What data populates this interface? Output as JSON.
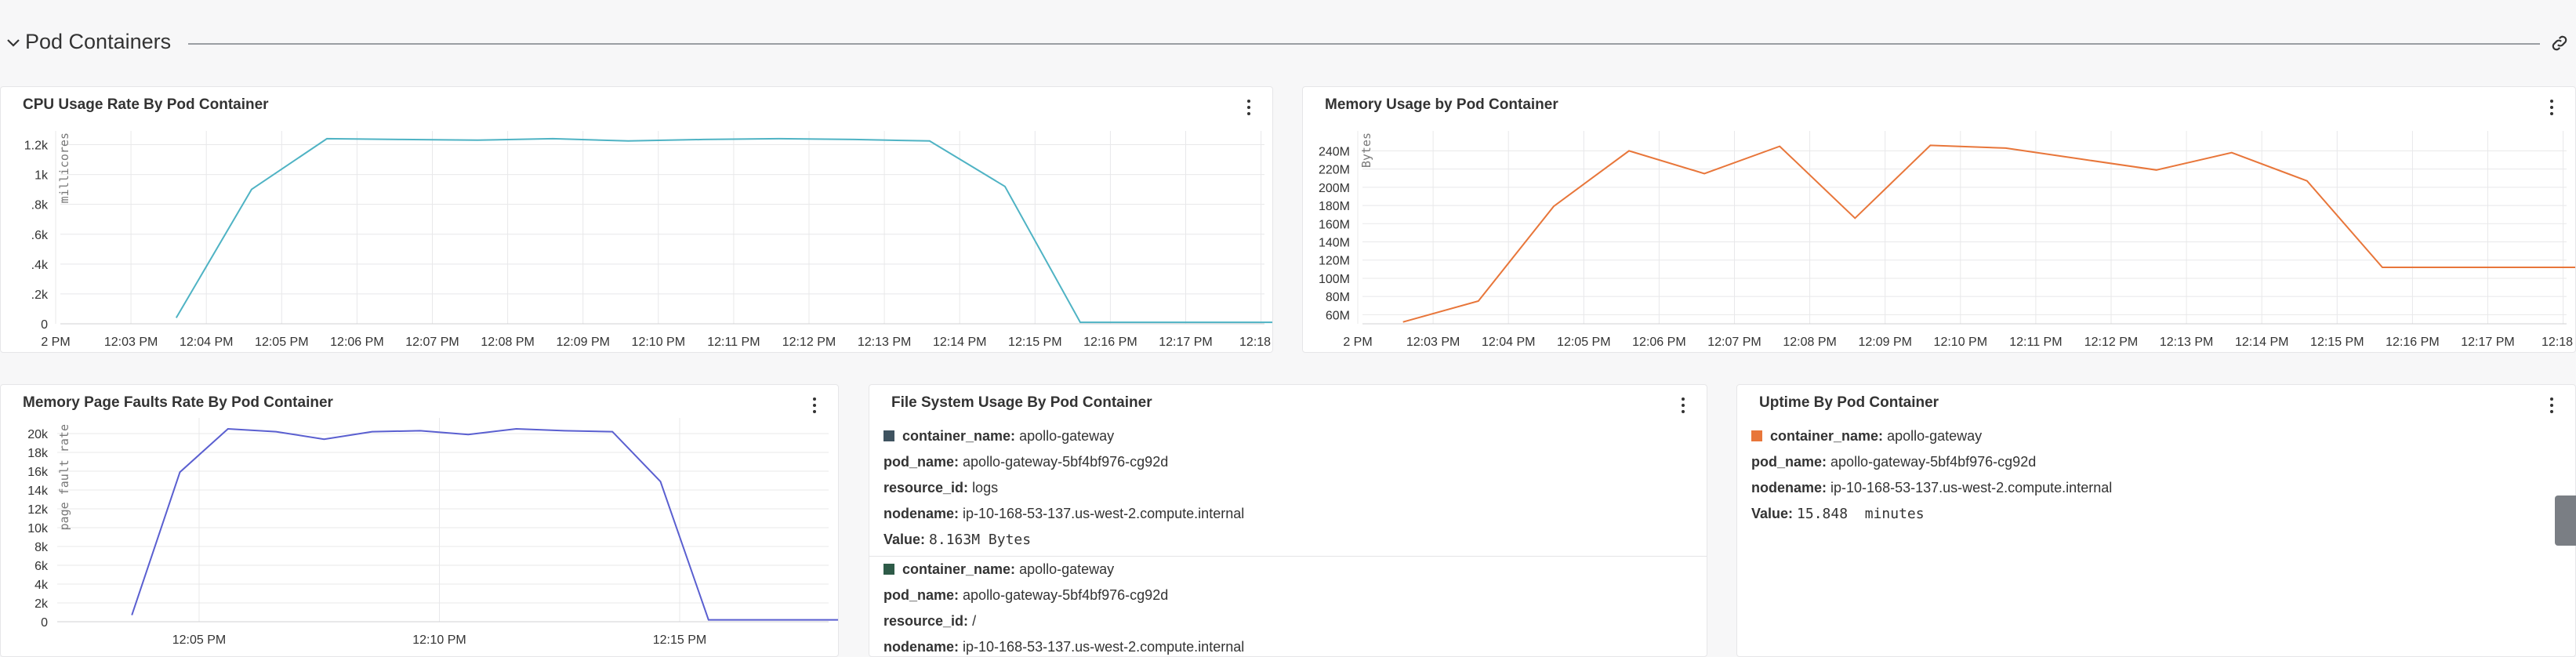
{
  "section": {
    "title": "Pod Containers"
  },
  "panels": {
    "cpu": {
      "title": "CPU Usage Rate By Pod Container",
      "y_axis_label": "millicores",
      "y_ticks": [
        "1.2k",
        "1k",
        ".8k",
        ".6k",
        ".4k",
        ".2k",
        "0"
      ],
      "x_ticks": [
        "2 PM",
        "12:03 PM",
        "12:04 PM",
        "12:05 PM",
        "12:06 PM",
        "12:07 PM",
        "12:08 PM",
        "12:09 PM",
        "12:10 PM",
        "12:11 PM",
        "12:12 PM",
        "12:13 PM",
        "12:14 PM",
        "12:15 PM",
        "12:16 PM",
        "12:17 PM",
        "12:18 P"
      ],
      "color": "#4fb3c4"
    },
    "memory": {
      "title": "Memory Usage by Pod Container",
      "y_axis_label": "Bytes",
      "y_ticks": [
        "240M",
        "220M",
        "200M",
        "180M",
        "160M",
        "140M",
        "120M",
        "100M",
        "80M",
        "60M"
      ],
      "x_ticks": [
        "2 PM",
        "12:03 PM",
        "12:04 PM",
        "12:05 PM",
        "12:06 PM",
        "12:07 PM",
        "12:08 PM",
        "12:09 PM",
        "12:10 PM",
        "12:11 PM",
        "12:12 PM",
        "12:13 PM",
        "12:14 PM",
        "12:15 PM",
        "12:16 PM",
        "12:17 PM",
        "12:18 P"
      ],
      "color": "#e8763a"
    },
    "faults": {
      "title": "Memory Page Faults Rate By Pod Container",
      "y_axis_label": "page fault rate",
      "y_ticks": [
        "20k",
        "18k",
        "16k",
        "14k",
        "12k",
        "10k",
        "8k",
        "6k",
        "4k",
        "2k",
        "0"
      ],
      "x_ticks": [
        "12:05 PM",
        "12:10 PM",
        "12:15 PM"
      ],
      "color": "#5a5fd0"
    },
    "filesystem": {
      "title": "File System Usage By Pod Container",
      "items": [
        {
          "color": "#3f5360",
          "container_name_label": "container_name:",
          "container_name": "apollo-gateway",
          "pod_name_label": "pod_name:",
          "pod_name": "apollo-gateway-5bf4bf976-cg92d",
          "resource_id_label": "resource_id:",
          "resource_id": "logs",
          "nodename_label": "nodename:",
          "nodename": "ip-10-168-53-137.us-west-2.compute.internal",
          "value_label": "Value:",
          "value": "8.163M Bytes"
        },
        {
          "color": "#2e5b48",
          "container_name_label": "container_name:",
          "container_name": "apollo-gateway",
          "pod_name_label": "pod_name:",
          "pod_name": "apollo-gateway-5bf4bf976-cg92d",
          "resource_id_label": "resource_id:",
          "resource_id": "/",
          "nodename_label": "nodename:",
          "nodename": "ip-10-168-53-137.us-west-2.compute.internal"
        }
      ]
    },
    "uptime": {
      "title": "Uptime By Pod Container",
      "item": {
        "color": "#e8763a",
        "container_name_label": "container_name:",
        "container_name": "apollo-gateway",
        "pod_name_label": "pod_name:",
        "pod_name": "apollo-gateway-5bf4bf976-cg92d",
        "nodename_label": "nodename:",
        "nodename": "ip-10-168-53-137.us-west-2.compute.internal",
        "value_label": "Value:",
        "value": "15.848  minutes"
      }
    }
  },
  "chart_data": [
    {
      "type": "line",
      "title": "CPU Usage Rate By Pod Container",
      "ylabel": "millicores",
      "ylim": [
        0,
        1250
      ],
      "x_ticks": [
        "12:03 PM",
        "12:04 PM",
        "12:05 PM",
        "12:06 PM",
        "12:07 PM",
        "12:08 PM",
        "12:09 PM",
        "12:10 PM",
        "12:11 PM",
        "12:12 PM",
        "12:13 PM",
        "12:14 PM",
        "12:15 PM",
        "12:16 PM",
        "12:17 PM"
      ],
      "series": [
        {
          "x": [
            "12:03:36",
            "12:04:36",
            "12:05:36",
            "12:06:36",
            "12:07:36",
            "12:08:36",
            "12:09:36",
            "12:10:36",
            "12:11:36",
            "12:12:36",
            "12:13:36",
            "12:14:36",
            "12:15:36",
            "12:16:36",
            "12:17:36",
            "12:18:36"
          ],
          "values": [
            40,
            900,
            1240,
            1235,
            1230,
            1240,
            1225,
            1235,
            1240,
            1235,
            1225,
            920,
            10,
            10,
            10,
            10
          ]
        }
      ]
    },
    {
      "type": "line",
      "title": "Memory Usage by Pod Container",
      "ylabel": "Bytes",
      "ylim": [
        50,
        255
      ],
      "x_ticks": [
        "12:03 PM",
        "12:04 PM",
        "12:05 PM",
        "12:06 PM",
        "12:07 PM",
        "12:08 PM",
        "12:09 PM",
        "12:10 PM",
        "12:11 PM",
        "12:12 PM",
        "12:13 PM",
        "12:14 PM",
        "12:15 PM",
        "12:16 PM",
        "12:17 PM"
      ],
      "series": [
        {
          "x": [
            "12:02:36",
            "12:03:36",
            "12:04:36",
            "12:05:36",
            "12:06:36",
            "12:07:36",
            "12:08:36",
            "12:09:36",
            "12:10:36",
            "12:11:36",
            "12:12:36",
            "12:13:36",
            "12:14:36",
            "12:15:36",
            "12:16:36",
            "12:17:36",
            "12:18:36"
          ],
          "values": [
            52,
            75,
            179,
            240,
            215,
            245,
            166,
            246,
            243,
            231,
            219,
            238,
            207,
            112,
            112,
            112,
            112
          ]
        }
      ]
    },
    {
      "type": "line",
      "title": "Memory Page Faults Rate By Pod Container",
      "ylabel": "page fault rate",
      "ylim": [
        0,
        21000
      ],
      "x_ticks": [
        "12:05 PM",
        "12:10 PM",
        "12:15 PM"
      ],
      "series": [
        {
          "x": [
            "12:03:36",
            "12:04:36",
            "12:05:36",
            "12:06:36",
            "12:07:36",
            "12:08:36",
            "12:09:36",
            "12:10:36",
            "12:11:36",
            "12:12:36",
            "12:13:36",
            "12:14:36",
            "12:15:36",
            "12:16:36",
            "12:17:36",
            "12:18:36"
          ],
          "values": [
            700,
            15900,
            20500,
            20200,
            19400,
            20200,
            20300,
            19900,
            20500,
            20300,
            20200,
            14900,
            200,
            200,
            200,
            200
          ]
        }
      ]
    }
  ]
}
